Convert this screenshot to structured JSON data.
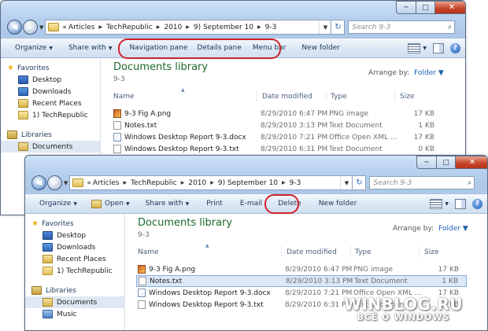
{
  "top_window": {
    "caption_buttons": {
      "minimize": "─",
      "maximize": "□",
      "close": "✕"
    },
    "address": {
      "back_glyph": "◀",
      "forward_glyph": "▶",
      "overflow": "«",
      "segments": [
        "Articles",
        "TechRepublic",
        "2010",
        "9) September 10",
        "9-3"
      ],
      "refresh_glyph": "↻",
      "search_placeholder": "Search 9-3"
    },
    "toolbar": {
      "organize": "Organize",
      "share_with": "Share with",
      "navigation_pane": "Navigation pane",
      "details_pane": "Details pane",
      "menu_bar": "Menu bar",
      "new_folder": "New folder",
      "help": "?"
    },
    "nav": {
      "favorites": "Favorites",
      "items": [
        "Desktop",
        "Downloads",
        "Recent Places",
        "1) TechRepublic"
      ],
      "libraries": "Libraries",
      "lib_items": [
        "Documents"
      ]
    },
    "library": {
      "title": "Documents library",
      "subtitle": "9-3",
      "arrange_label": "Arrange by:",
      "arrange_value": "Folder"
    },
    "columns": {
      "name": "Name",
      "date": "Date modified",
      "type": "Type",
      "size": "Size"
    },
    "files": [
      {
        "name": "9-3 Fig A.png",
        "date": "8/29/2010 6:47 PM",
        "type": "PNG image",
        "size": "17 KB",
        "icon": "png"
      },
      {
        "name": "Notes.txt",
        "date": "8/29/2010 3:13 PM",
        "type": "Text Document",
        "size": "1 KB",
        "icon": "txt"
      },
      {
        "name": "Windows Desktop Report 9-3.docx",
        "date": "8/29/2010 7:21 PM",
        "type": "Office Open XML ...",
        "size": "17 KB",
        "icon": "docx"
      },
      {
        "name": "Windows Desktop Report 9-3.txt",
        "date": "8/29/2010 6:31 PM",
        "type": "Text Document",
        "size": "0 KB",
        "icon": "txt"
      }
    ]
  },
  "bottom_window": {
    "caption_buttons": {
      "minimize": "─",
      "maximize": "□",
      "close": "✕"
    },
    "address": {
      "back_glyph": "◀",
      "forward_glyph": "▶",
      "overflow": "«",
      "segments": [
        "Articles",
        "TechRepublic",
        "2010",
        "9) September 10",
        "9-3"
      ],
      "refresh_glyph": "↻",
      "search_placeholder": "Search 9-3"
    },
    "toolbar": {
      "organize": "Organize",
      "open": "Open",
      "share_with": "Share with",
      "print": "Print",
      "email": "E-mail",
      "delete": "Delete",
      "new_folder": "New folder",
      "help": "?"
    },
    "nav": {
      "favorites": "Favorites",
      "items": [
        "Desktop",
        "Downloads",
        "Recent Places",
        "1) TechRepublic"
      ],
      "libraries": "Libraries",
      "lib_items": [
        "Documents",
        "Music"
      ]
    },
    "library": {
      "title": "Documents library",
      "subtitle": "9-3",
      "arrange_label": "Arrange by:",
      "arrange_value": "Folder"
    },
    "columns": {
      "name": "Name",
      "date": "Date modified",
      "type": "Type",
      "size": "Size"
    },
    "files": [
      {
        "name": "9-3 Fig A.png",
        "date": "8/29/2010 6:47 PM",
        "type": "PNG image",
        "size": "17 KB",
        "icon": "png"
      },
      {
        "name": "Notes.txt",
        "date": "8/29/2010 3:13 PM",
        "type": "Text Document",
        "size": "1 KB",
        "icon": "txt",
        "selected": true
      },
      {
        "name": "Windows Desktop Report 9-3.docx",
        "date": "8/29/2010 7:21 PM",
        "type": "Office Open XML ...",
        "size": "17 KB",
        "icon": "docx"
      },
      {
        "name": "Windows Desktop Report 9-3.txt",
        "date": "8/29/2010 6:31 PM",
        "type": "Text Document",
        "size": "0 KB",
        "icon": "txt"
      }
    ]
  },
  "watermark": {
    "line1": "WINBLOG.RU",
    "line2": "ВСЁ О WINDOWS"
  },
  "colors": {
    "highlight_oval": "#d0212a",
    "library_title": "#1c6a2c",
    "link_blue": "#1e5fb4"
  }
}
